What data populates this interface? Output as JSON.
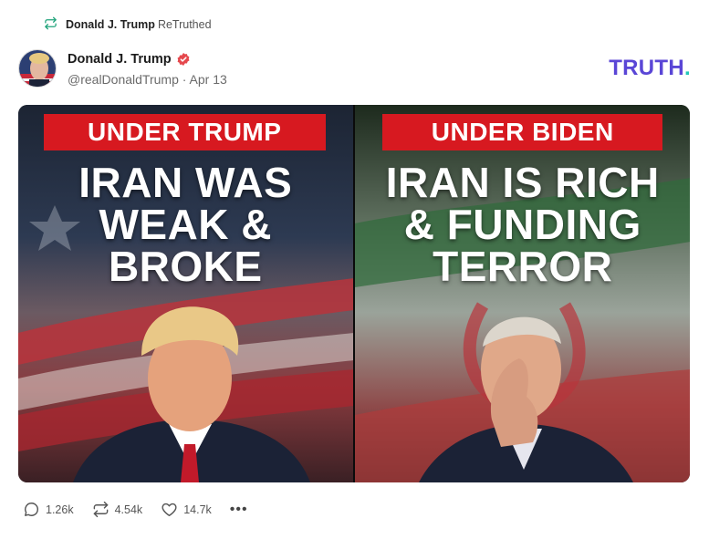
{
  "retruth": {
    "icon": "retruth-icon",
    "name": "Donald J. Trump",
    "suffix": "ReTruthed"
  },
  "author": {
    "name": "Donald J. Trump",
    "verified": true,
    "meta": "@realDonaldTrump · Apr 13"
  },
  "brand": {
    "logo_main": "TRUTH",
    "logo_dot": ".",
    "logo_color": "#5a46d6",
    "dot_color": "#23c8b8"
  },
  "media": {
    "left": {
      "banner": "UNDER TRUMP",
      "lines": [
        "IRAN WAS",
        "WEAK &",
        "BROKE"
      ]
    },
    "right": {
      "banner": "UNDER BIDEN",
      "lines": [
        "IRAN IS RICH",
        "& FUNDING",
        "TERROR"
      ]
    },
    "banner_color": "#d71920"
  },
  "actions": {
    "replies": "1.26k",
    "retruths": "4.54k",
    "likes": "14.7k",
    "more": "•••"
  }
}
